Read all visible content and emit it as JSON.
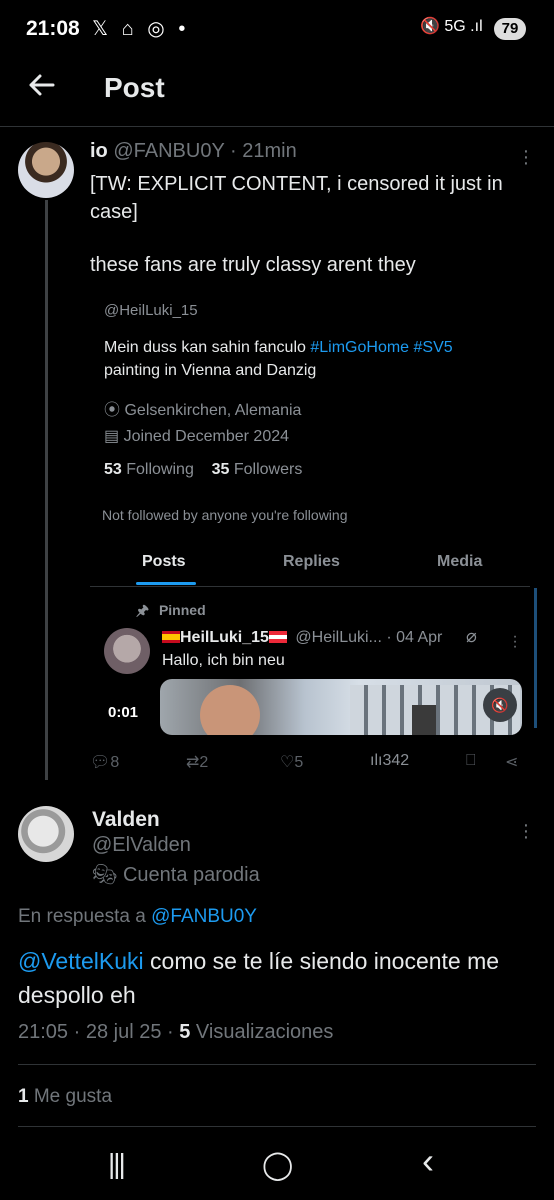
{
  "status_bar": {
    "time": "21:08",
    "left_icons": "𝕏 ⌂ ◎ •",
    "signal": "5G",
    "battery": "79"
  },
  "header": {
    "title": "Post"
  },
  "post": {
    "name": "io",
    "handle": "@FANBU0Y",
    "time": "· 21min",
    "text_1": "[TW: EXPLICIT CONTENT, i censored it just in case]",
    "text_2": "these fans are truly classy arent they"
  },
  "screenshot": {
    "handle": "@HeilLuki_15",
    "bio_text": "Mein duss kan sahin fanculo",
    "hashtags": "#LimGoHome #SV5",
    "bio_line2": "painting in Vienna and Danzig",
    "location": "Gelsenkirchen, Alemania",
    "joined": "Joined December 2024",
    "following_count": "53",
    "following_label": "Following",
    "followers_count": "35",
    "followers_label": "Followers",
    "not_followed": "Not followed by anyone you're following",
    "tabs": [
      "Posts",
      "Replies",
      "Media"
    ],
    "pinned_label": "Pinned",
    "rt_name": "HeilLuki_15",
    "rt_handle": "@HeilLuki... · 04 Apr",
    "rt_text": "Hallo, ich bin neu",
    "video_time": "0:01",
    "actions": {
      "replies": "8",
      "reposts": "2",
      "likes": "5",
      "views": "342"
    }
  },
  "reply": {
    "name": "Valden",
    "handle": "@ElValden",
    "badge": "Cuenta parodia",
    "reply_prefix": "En respuesta a",
    "reply_to": "@FANBU0Y",
    "mention": "@VettelKuki",
    "text": "como se te líe siendo inocente me despollo eh",
    "meta_time": "21:05 · 28 jul 25 ·",
    "views_count": "5",
    "views_label": "Visualizaciones",
    "likes_count": "1",
    "likes_label": "Me gusta"
  },
  "nav": {
    "recent": "|||",
    "home": "◯",
    "back": "‹"
  },
  "colors": {
    "accent": "#1d9bf0",
    "muted": "#71767b",
    "border": "#2f3336"
  }
}
